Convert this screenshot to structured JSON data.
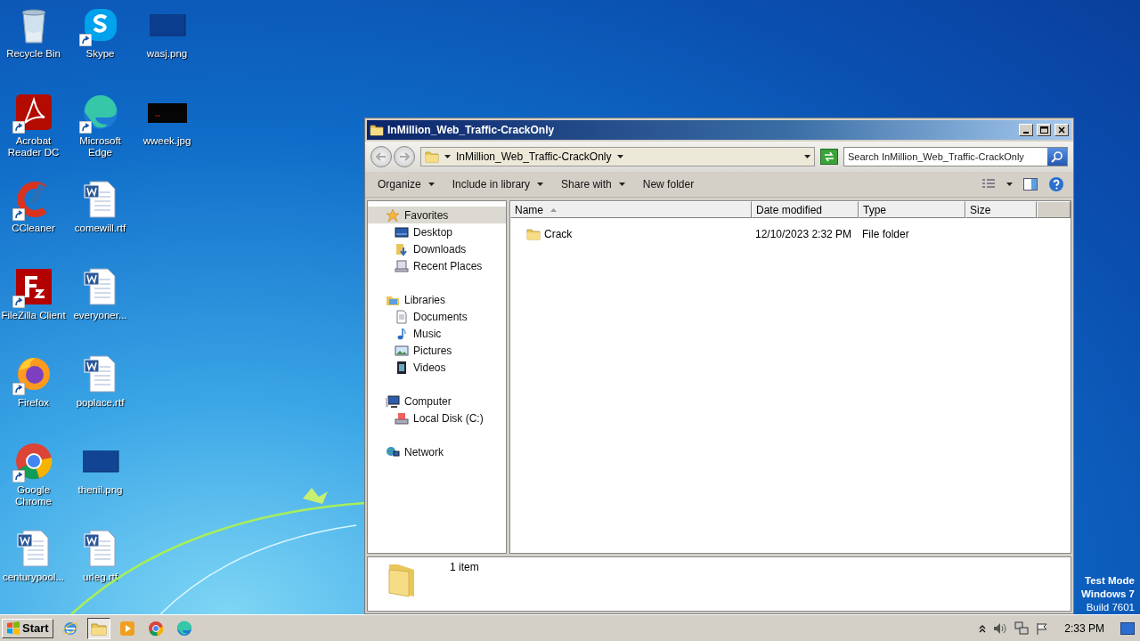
{
  "desktop": {
    "icons": [
      {
        "label": "Recycle Bin",
        "kind": "recycle",
        "shortcut": false
      },
      {
        "label": "Acrobat Reader DC",
        "kind": "acrobat",
        "shortcut": true
      },
      {
        "label": "CCleaner",
        "kind": "ccleaner",
        "shortcut": true
      },
      {
        "label": "FileZilla Client",
        "kind": "filezilla",
        "shortcut": true
      },
      {
        "label": "Firefox",
        "kind": "firefox",
        "shortcut": true
      },
      {
        "label": "Google Chrome",
        "kind": "chrome",
        "shortcut": true
      },
      {
        "label": "centurypool...",
        "kind": "word",
        "shortcut": false
      },
      {
        "label": "Skype",
        "kind": "skype",
        "shortcut": true
      },
      {
        "label": "Microsoft Edge",
        "kind": "edge",
        "shortcut": true
      },
      {
        "label": "comewill.rtf",
        "kind": "word",
        "shortcut": false
      },
      {
        "label": "everyoner...",
        "kind": "word",
        "shortcut": false
      },
      {
        "label": "poplace.rtf",
        "kind": "word",
        "shortcut": false
      },
      {
        "label": "thenil.png",
        "kind": "image",
        "shortcut": false
      },
      {
        "label": "urleg.rtf",
        "kind": "word",
        "shortcut": false
      },
      {
        "label": "wasj.png",
        "kind": "image",
        "shortcut": false
      },
      {
        "label": "wweek.jpg",
        "kind": "dark-image",
        "shortcut": false
      }
    ],
    "test_mode": [
      "Test Mode",
      "Windows 7",
      "Build 7601"
    ]
  },
  "window": {
    "title": "InMillion_Web_Traffic-CrackOnly",
    "address": {
      "path": "InMillion_Web_Traffic-CrackOnly"
    },
    "search": {
      "placeholder": "Search InMillion_Web_Traffic-CrackOnly"
    },
    "toolbar": [
      {
        "label": "Organize",
        "dropdown": true
      },
      {
        "label": "Include in library",
        "dropdown": true
      },
      {
        "label": "Share with",
        "dropdown": true
      },
      {
        "label": "New folder",
        "dropdown": false
      }
    ],
    "nav": [
      {
        "label": "Favorites",
        "kind": "star",
        "selected": true,
        "children": [
          {
            "label": "Desktop",
            "kind": "desktop",
            "selected": false
          },
          {
            "label": "Downloads",
            "kind": "downloads",
            "selected": false
          },
          {
            "label": "Recent Places",
            "kind": "recent",
            "selected": false
          }
        ]
      },
      {
        "label": "Libraries",
        "kind": "library",
        "selected": false,
        "children": [
          {
            "label": "Documents",
            "kind": "document",
            "selected": false
          },
          {
            "label": "Music",
            "kind": "music",
            "selected": false
          },
          {
            "label": "Pictures",
            "kind": "pictures",
            "selected": false
          },
          {
            "label": "Videos",
            "kind": "videos",
            "selected": false
          }
        ]
      },
      {
        "label": "Computer",
        "kind": "computer",
        "selected": false,
        "children": [
          {
            "label": "Local Disk (C:)",
            "kind": "disk",
            "selected": false
          }
        ]
      },
      {
        "label": "Network",
        "kind": "network",
        "selected": false
      }
    ],
    "columns": [
      {
        "label": "Name",
        "sorted": true
      },
      {
        "label": "Date modified",
        "sorted": false
      },
      {
        "label": "Type",
        "sorted": false
      },
      {
        "label": "Size",
        "sorted": false
      }
    ],
    "rows": [
      {
        "name": "Crack",
        "date_modified": "12/10/2023 2:32 PM",
        "type": "File folder"
      }
    ],
    "status": "1 item"
  },
  "taskbar": {
    "start": "Start",
    "apps": [
      {
        "kind": "ie",
        "active": false
      },
      {
        "kind": "explorer",
        "active": true
      },
      {
        "kind": "media",
        "active": false
      },
      {
        "kind": "chrome",
        "active": false
      },
      {
        "kind": "edge",
        "active": false
      }
    ],
    "clock": "2:33 PM"
  }
}
